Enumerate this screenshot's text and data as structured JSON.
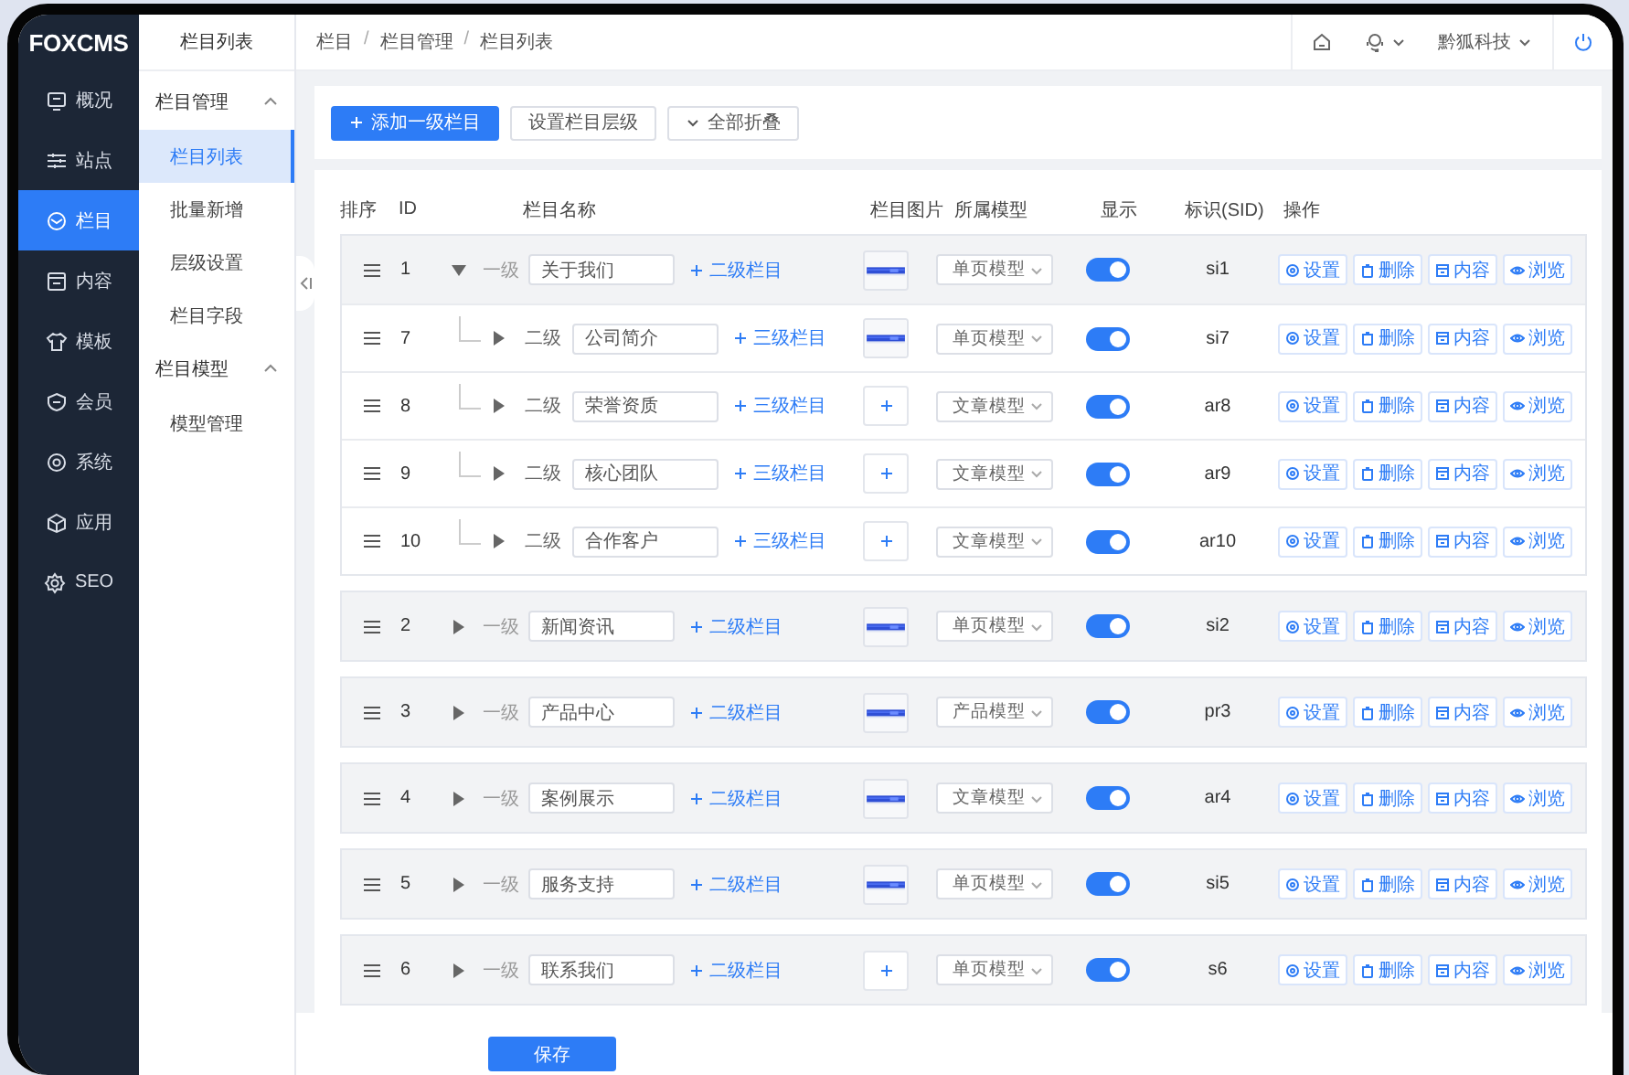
{
  "brand": "FOXCMS",
  "nav": [
    {
      "label": "概况",
      "selected": false
    },
    {
      "label": "站点",
      "selected": false
    },
    {
      "label": "栏目",
      "selected": true
    },
    {
      "label": "内容",
      "selected": false
    },
    {
      "label": "模板",
      "selected": false
    },
    {
      "label": "会员",
      "selected": false
    },
    {
      "label": "系统",
      "selected": false
    },
    {
      "label": "应用",
      "selected": false
    },
    {
      "label": "SEO",
      "selected": false
    }
  ],
  "subnav": {
    "title": "栏目列表",
    "groups": [
      {
        "label": "栏目管理",
        "expanded": true,
        "items": [
          {
            "label": "栏目列表",
            "selected": true
          },
          {
            "label": "批量新增",
            "selected": false
          },
          {
            "label": "层级设置",
            "selected": false
          },
          {
            "label": "栏目字段",
            "selected": false
          }
        ]
      },
      {
        "label": "栏目模型",
        "expanded": true,
        "items": [
          {
            "label": "模型管理",
            "selected": false
          }
        ]
      }
    ]
  },
  "breadcrumb": [
    {
      "label": "栏目",
      "kind": "crumb"
    },
    {
      "label": "/",
      "kind": "sep"
    },
    {
      "label": "栏目管理",
      "kind": "crumb"
    },
    {
      "label": "/",
      "kind": "sep"
    },
    {
      "label": "栏目列表",
      "kind": "crumb"
    }
  ],
  "header": {
    "user": "黔狐科技"
  },
  "toolbar": [
    {
      "label": "添加一级栏目",
      "kind": "primary"
    },
    {
      "label": "设置栏目层级",
      "kind": "plain"
    },
    {
      "label": "全部折叠",
      "kind": "collapse"
    }
  ],
  "table": {
    "columns": [
      "排序",
      "ID",
      "栏目名称",
      "栏目图片",
      "所属模型",
      "显示",
      "标识(SID)",
      "操作"
    ],
    "rows": [
      {
        "id": "1",
        "level": "一级",
        "name": "关于我们",
        "add": "二级栏目",
        "thumb": {
          "kind": "picture"
        },
        "model": "单页模型",
        "on": true,
        "sid": "si1",
        "expanded": true,
        "actions": [
          "设置",
          "删除",
          "内容",
          "浏览"
        ],
        "children": [
          {
            "id": "7",
            "level": "二级",
            "name": "公司简介",
            "add": "三级栏目",
            "thumb": {
              "kind": "picture"
            },
            "model": "单页模型",
            "on": true,
            "sid": "si7",
            "expanded": false,
            "actions": [
              "设置",
              "删除",
              "内容",
              "浏览"
            ]
          },
          {
            "id": "8",
            "level": "二级",
            "name": "荣誉资质",
            "add": "三级栏目",
            "thumb": {
              "kind": "upload"
            },
            "model": "文章模型",
            "on": true,
            "sid": "ar8",
            "expanded": false,
            "actions": [
              "设置",
              "删除",
              "内容",
              "浏览"
            ]
          },
          {
            "id": "9",
            "level": "二级",
            "name": "核心团队",
            "add": "三级栏目",
            "thumb": {
              "kind": "upload"
            },
            "model": "文章模型",
            "on": true,
            "sid": "ar9",
            "expanded": false,
            "actions": [
              "设置",
              "删除",
              "内容",
              "浏览"
            ]
          },
          {
            "id": "10",
            "level": "二级",
            "name": "合作客户",
            "add": "三级栏目",
            "thumb": {
              "kind": "upload"
            },
            "model": "文章模型",
            "on": true,
            "sid": "ar10",
            "expanded": false,
            "actions": [
              "设置",
              "删除",
              "内容",
              "浏览"
            ]
          }
        ]
      },
      {
        "id": "2",
        "level": "一级",
        "name": "新闻资讯",
        "add": "二级栏目",
        "thumb": {
          "kind": "picture"
        },
        "model": "单页模型",
        "on": true,
        "sid": "si2",
        "expanded": false,
        "actions": [
          "设置",
          "删除",
          "内容",
          "浏览"
        ]
      },
      {
        "id": "3",
        "level": "一级",
        "name": "产品中心",
        "add": "二级栏目",
        "thumb": {
          "kind": "picture"
        },
        "model": "产品模型",
        "on": true,
        "sid": "pr3",
        "expanded": false,
        "actions": [
          "设置",
          "删除",
          "内容",
          "浏览"
        ]
      },
      {
        "id": "4",
        "level": "一级",
        "name": "案例展示",
        "add": "二级栏目",
        "thumb": {
          "kind": "picture"
        },
        "model": "文章模型",
        "on": true,
        "sid": "ar4",
        "expanded": false,
        "actions": [
          "设置",
          "删除",
          "内容",
          "浏览"
        ]
      },
      {
        "id": "5",
        "level": "一级",
        "name": "服务支持",
        "add": "二级栏目",
        "thumb": {
          "kind": "picture"
        },
        "model": "单页模型",
        "on": true,
        "sid": "si5",
        "expanded": false,
        "actions": [
          "设置",
          "删除",
          "内容",
          "浏览"
        ]
      },
      {
        "id": "6",
        "level": "一级",
        "name": "联系我们",
        "add": "二级栏目",
        "thumb": {
          "kind": "upload"
        },
        "model": "单页模型",
        "on": true,
        "sid": "s6",
        "expanded": false,
        "actions": [
          "设置",
          "删除",
          "内容",
          "浏览"
        ]
      }
    ]
  },
  "footer": {
    "save": "保存"
  }
}
